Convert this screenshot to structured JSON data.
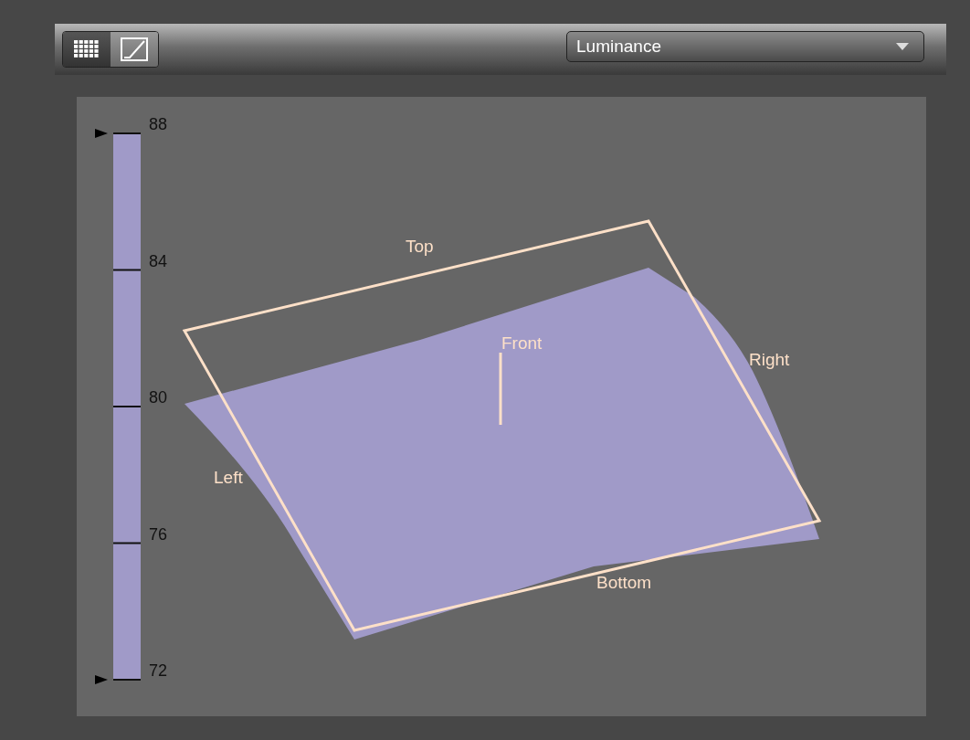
{
  "toolbar": {
    "view_buttons": [
      {
        "kind": "grid",
        "selected": false
      },
      {
        "kind": "curve",
        "selected": true
      }
    ],
    "dropdown": {
      "value": "Luminance"
    }
  },
  "legend": {
    "ticks": [
      "88",
      "84",
      "80",
      "76",
      "72"
    ]
  },
  "plot": {
    "labels": [
      {
        "kind": "top",
        "text": "Top"
      },
      {
        "kind": "front",
        "text": "Front"
      },
      {
        "kind": "right",
        "text": "Right"
      },
      {
        "kind": "left",
        "text": "Left"
      },
      {
        "kind": "bottom",
        "text": "Bottom"
      }
    ]
  }
}
